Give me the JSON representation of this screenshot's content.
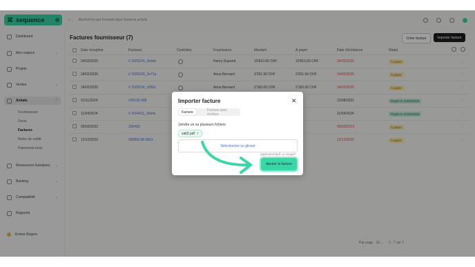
{
  "app": {
    "brand": "sequence",
    "colors": {
      "accent": "#39d6a8",
      "dark": "#1e1e1e",
      "link": "#4a6fd1",
      "danger": "#e04a4a"
    }
  },
  "sidebar": {
    "items": [
      {
        "label": "Dashboard",
        "icon": "dashboard-icon"
      },
      {
        "label": "Mon espace",
        "icon": "user-icon",
        "chevron": "⌄"
      },
      {
        "label": "Projets",
        "icon": "check-square-icon"
      },
      {
        "label": "Ventes",
        "icon": "sales-icon",
        "chevron": "⌄"
      },
      {
        "label": "Achats",
        "icon": "bag-icon",
        "chevron": "⌃"
      },
      {
        "label": "Ressources humaines",
        "icon": "people-icon",
        "chevron": "⌄"
      },
      {
        "label": "Banking",
        "icon": "bank-icon",
        "chevron": "⌄"
      },
      {
        "label": "Comptabilité",
        "icon": "ledger-icon",
        "chevron": "⌄"
      },
      {
        "label": "Rapports",
        "icon": "chart-icon"
      }
    ],
    "sub_items": [
      "Fournisseurs",
      "Devis",
      "Factures",
      "Notes de crédit",
      "Paiements émis"
    ],
    "user": "Emma Rogers"
  },
  "topbar": {
    "search_placeholder": "Recherche par montant dans factures achats"
  },
  "page": {
    "title": "Factures fournisseur (7)",
    "create_button": "Créer facture",
    "import_button": "Importer facture"
  },
  "table": {
    "headers": [
      "Date réception",
      "Factures",
      "Contrôles",
      "Fournisseur",
      "Montant",
      "À payer",
      "Date d'échéance",
      "Statut"
    ],
    "rows": [
      {
        "date": "24/02/2025",
        "invoice": "# 2025224_3e9eb",
        "supplier": "Henry Dupond",
        "amount": "10'810.00 CHF",
        "to_pay": "10'810.00 CHF",
        "due": "24/02/2025",
        "status": "À payer",
        "status_type": "pending",
        "due_red": true
      },
      {
        "date": "24/02/2025",
        "invoice": "# 2025224_3e71a",
        "supplier": "Anna Bernard",
        "amount": "3'251.50 CHF",
        "to_pay": "3'251.50 CHF",
        "due": "24/02/2025",
        "status": "À payer",
        "status_type": "pending",
        "due_red": true
      },
      {
        "date": "24/02/2025",
        "invoice": "# 2025224_c85b1",
        "supplier": "Anna Bernard",
        "amount": "2'160.00 CHF",
        "to_pay": "2'160.00 CHF",
        "due": "24/02/2025",
        "status": "À payer",
        "status_type": "pending",
        "due_red": true
      },
      {
        "date": "01/11/2024",
        "invoice": "#29115-908",
        "supplier": "",
        "amount": "",
        "to_pay": "CHF",
        "due": "22/08/2021",
        "status": "Payée le 24/02/2025",
        "status_type": "paid",
        "due_red": false
      },
      {
        "date": "11/04/2024",
        "invoice": "# 2024411_d0a4c",
        "supplier": "",
        "amount": "",
        "to_pay": "CHF",
        "due": "11/04/2024",
        "status": "Payée le 24/02/2025",
        "status_type": "paid",
        "due_red": false
      },
      {
        "date": "05/03/2023",
        "invoice": "205458",
        "supplier": "",
        "amount": "",
        "to_pay": "CHF",
        "due": "05/03/2023",
        "status": "À payer",
        "status_type": "pending",
        "due_red": true
      },
      {
        "date": "12/12/2022",
        "invoice": "90980C48-0001",
        "supplier": "",
        "amount": "",
        "to_pay": "CHF",
        "due": "12/12/2022",
        "status": "À payer",
        "status_type": "pending",
        "due_red": true
      }
    ]
  },
  "pager": {
    "per_page_label": "Par page",
    "per_page": "10",
    "range": "1 - 7 sur 7"
  },
  "modal": {
    "title": "Importer facture",
    "tab_active": "Facture",
    "tab_inactive": "Facture sans écriture",
    "attach_label": "Joindre un ou plusieurs fichiers",
    "file_chip": "salt2.pdf",
    "dropzone": "Sélectionner ou glisser",
    "hint": "application/pdf ou image/*",
    "submit": "Ajouter la facture"
  }
}
